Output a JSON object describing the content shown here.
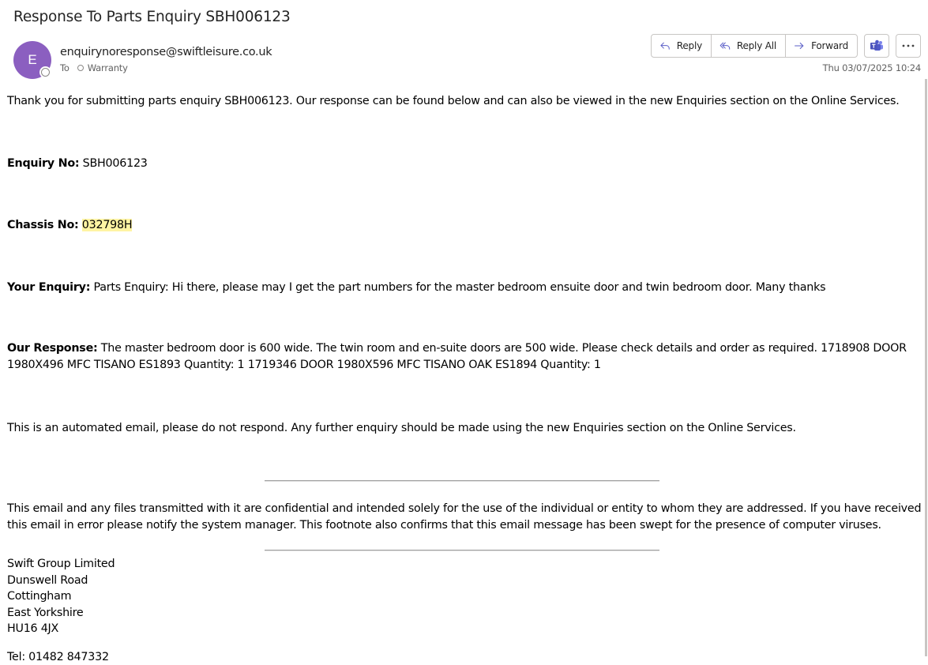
{
  "email": {
    "subject": "Response To Parts Enquiry SBH006123",
    "avatar_initial": "E",
    "avatar_color": "#8b5fc0",
    "sender": "enquirynoresponse@swiftleisure.co.uk",
    "to_label": "To",
    "recipient": "Warranty",
    "date": "Thu 03/07/2025 10:24"
  },
  "actions": {
    "reply": "Reply",
    "reply_all": "Reply All",
    "forward": "Forward",
    "teams_icon": "teams-icon",
    "more_icon": "more-options-icon"
  },
  "body": {
    "intro": "Thank you for submitting parts enquiry SBH006123. Our response can be found below and can also be viewed in the new Enquiries section on the Online Services.",
    "enquiry_no_label": "Enquiry No:",
    "enquiry_no_value": "SBH006123",
    "chassis_no_label": "Chassis No:",
    "chassis_no_value": "032798H",
    "your_enquiry_label": "Your Enquiry:",
    "your_enquiry_value": "Parts Enquiry: Hi there, please may I get the part numbers for the master bedroom ensuite door and twin bedroom door. Many thanks",
    "our_response_label": "Our Response:",
    "our_response_value": "The master bedroom door is 600 wide. The twin room and en-suite doors are 500 wide. Please check details and order as required. 1718908 DOOR 1980X496 MFC TISANO ES1893 Quantity: 1 1719346 DOOR 1980X596 MFC TISANO OAK ES1894 Quantity: 1",
    "automated_note": "This is an automated email, please do not respond. Any further enquiry should be made using the new Enquiries section on the Online Services.",
    "disclaimer": "This email and any files transmitted with it are confidential and intended solely for the use of the individual or entity to whom they are addressed. If you have received this email in error please notify the system manager. This footnote also confirms that this email message has been swept for the presence of computer viruses.",
    "highlight_color": "#fff4a3"
  },
  "signature": {
    "company": "Swift Group Limited",
    "street": "Dunswell Road",
    "town": "Cottingham",
    "county": "East Yorkshire",
    "postcode": "HU16 4JX",
    "tel": "Tel: 01482 847332"
  }
}
